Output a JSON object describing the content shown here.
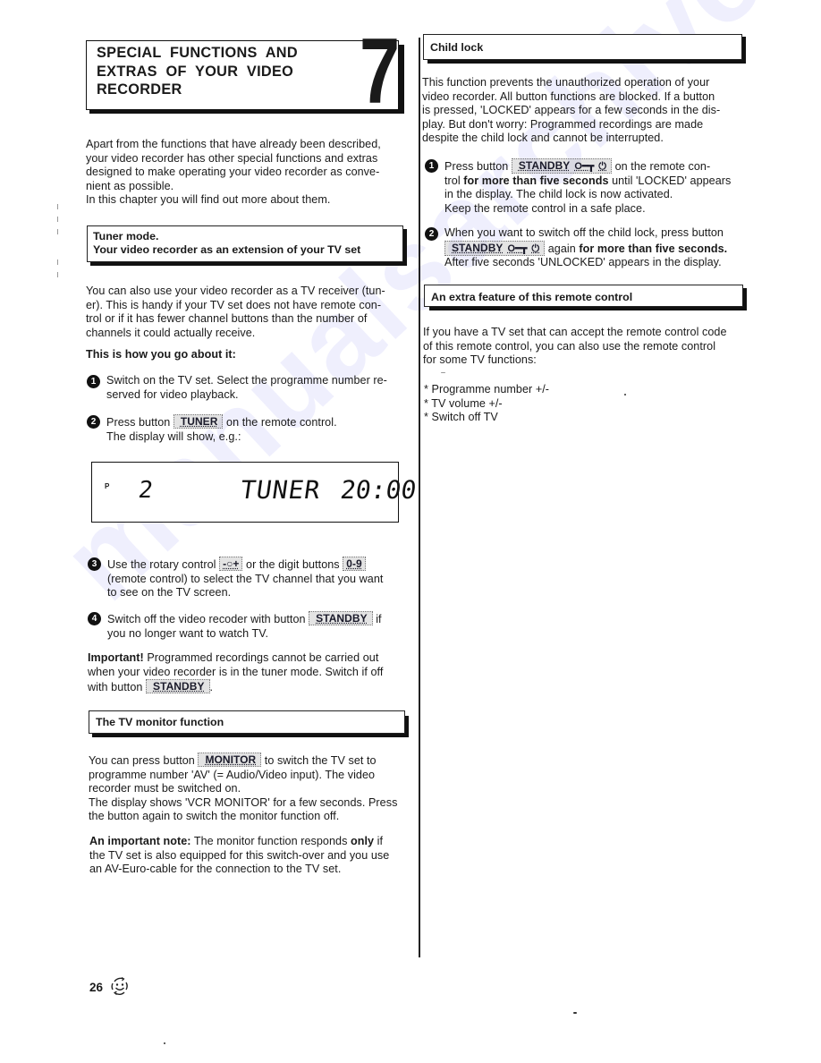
{
  "chapter": {
    "title_lines": [
      "SPECIAL  FUNCTIONS  AND",
      "EXTRAS  OF  YOUR  VIDEO",
      "RECORDER"
    ],
    "number": "7"
  },
  "intro": {
    "lines": [
      "Apart from the functions that have already been described,",
      "your video recorder has other special functions and extras",
      "designed to make operating your video recorder as conve-",
      "nient as possible.",
      "In this chapter you will find out more about them."
    ]
  },
  "tuner_section": {
    "title_line1": "Tuner mode.",
    "title_line2": "Your video recorder as an extension of your TV set",
    "para_lines": [
      "You can also use your video recorder as a TV receiver (tun-",
      "er). This is handy if your TV set does not have remote con-",
      "trol or if it has fewer channel buttons than the number of",
      "channels it could actually receive."
    ],
    "how_to": "This is how you go about it:",
    "steps": [
      {
        "num": "1",
        "lines": [
          "Switch on the TV set. Select the programme number re-",
          "served for video playback."
        ]
      },
      {
        "num": "2",
        "pre": "Press button",
        "button": "TUNER",
        "post": "on the remote control.",
        "line2": "The display will show, e.g.:"
      },
      {
        "num": "3",
        "pre": "Use the rotary control",
        "button": "-○+",
        "mid": "or the digit buttons",
        "button2": "0-9",
        "line2": "(remote control) to select the TV channel that you want",
        "line3": "to see on the TV screen."
      },
      {
        "num": "4",
        "pre": "Switch off the video recoder with button",
        "button": "STANDBY",
        "post": "if",
        "line2": "you no longer want to watch TV."
      }
    ],
    "display": {
      "p_label": "P",
      "programme": "2",
      "mode": "TUNER",
      "time": "20:00"
    },
    "important_label": "Important!",
    "important_line1": " Programmed recordings cannot be carried out",
    "important_line2": "when your video recorder is in the tuner mode. Switch if off",
    "important_line3_pre": "with button",
    "important_button": "STANDBY",
    "important_line3_post": "."
  },
  "monitor_section": {
    "title": "The TV monitor function",
    "line1_pre": "You can press button",
    "button": "MONITOR",
    "line1_post": "to switch the TV set to",
    "lines": [
      "programme number 'AV' (= Audio/Video input). The video",
      "recorder must be switched on.",
      "The display shows 'VCR MONITOR' for a few seconds. Press",
      "the button again to switch the monitor function off."
    ],
    "note_label": "An important note:",
    "note_line1_mid": " The monitor function responds ",
    "note_only": "only",
    "note_line1_end": " if",
    "note_lines": [
      "the TV set is also equipped for this switch-over and you use",
      "an AV-Euro-cable for the connection to the TV set."
    ]
  },
  "child_lock": {
    "title": "Child lock",
    "para_lines": [
      "This function prevents the unauthorized operation of your",
      "video recorder. All button functions are blocked. If a button",
      "is pressed, 'LOCKED' appears for a few seconds in the dis-",
      "play. But don't worry: Programmed recordings are made",
      "despite the child lock and cannot be interrupted."
    ],
    "step1": {
      "num": "1",
      "pre": "Press button",
      "button": "STANDBY",
      "key_glyph": "O━┳",
      "power_glyph": "⏻",
      "post": "on the remote con-",
      "line2_pre": "trol ",
      "line2_bold": "for more than five seconds",
      "line2_post": " until 'LOCKED' appears",
      "line3": "in the display. The child lock is now activated.",
      "line4": "Keep the remote control in a safe place."
    },
    "step2": {
      "num": "2",
      "line1": "When you want to switch off the child lock, press button",
      "button": "STANDBY",
      "key_glyph": "O━┳",
      "power_glyph": "⏻",
      "line2_pre": " again ",
      "line2_bold": "for more than five seconds.",
      "line3": "After five seconds 'UNLOCKED' appears in the display."
    }
  },
  "extra_feature": {
    "title": "An extra feature of this remote control",
    "para_lines": [
      "If you have a TV set that can accept the remote control code",
      "of this remote control, you can also use the remote control",
      "for some TV functions:"
    ],
    "list": [
      "* Programme number +/-",
      "* TV volume +/-",
      "* Switch off TV"
    ]
  },
  "footer": {
    "page_number": "26",
    "icon": "smiley-face-icon"
  },
  "watermark": "manualsarchive.com"
}
